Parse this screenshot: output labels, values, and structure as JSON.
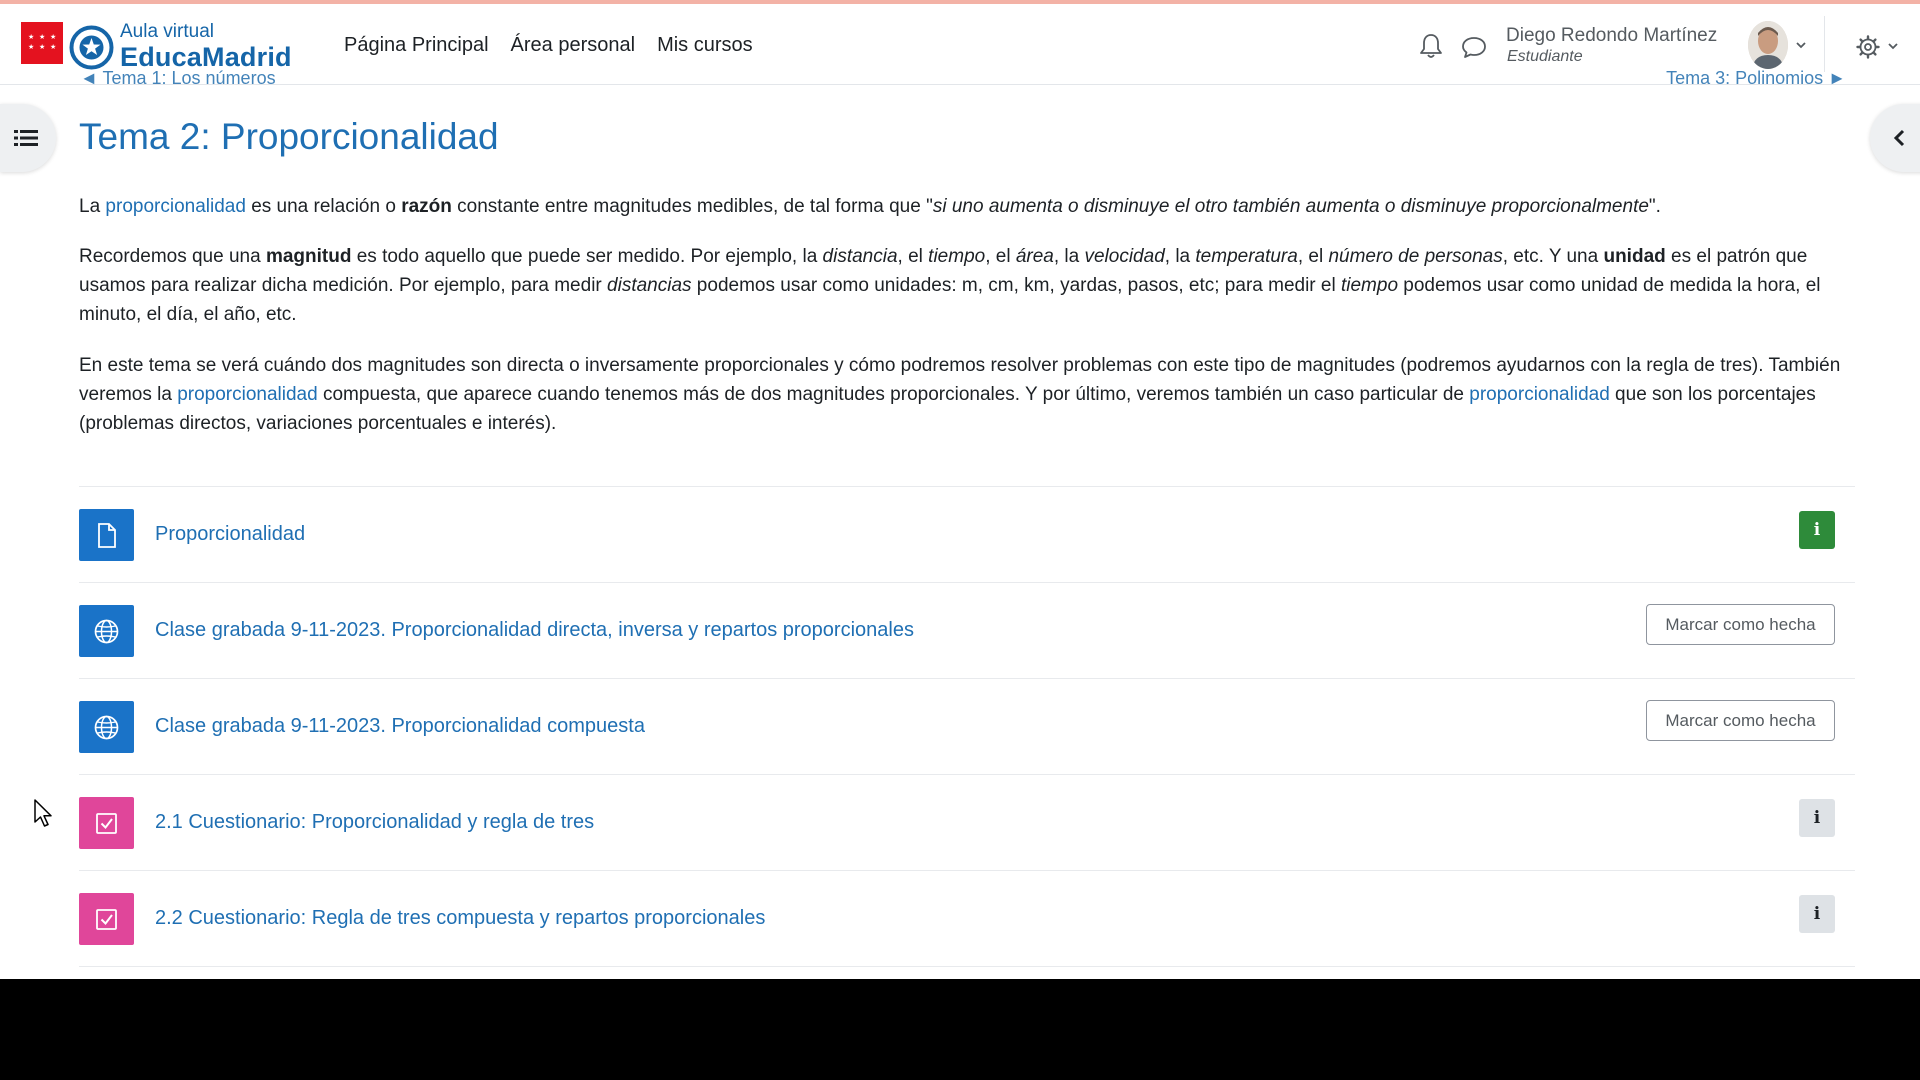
{
  "header": {
    "logo_small": "Aula virtual",
    "logo_big": "EducaMadrid",
    "nav": [
      "Página Principal",
      "Área personal",
      "Mis cursos"
    ],
    "user_name": "Diego Redondo Martínez",
    "user_role": "Estudiante",
    "icons": [
      "bell-icon",
      "chat-icon",
      "gear-icon",
      "chevron-down-icon"
    ]
  },
  "navigation": {
    "prev": "◄ Tema 1: Los números",
    "next": "Tema 3: Polinomios ►"
  },
  "section": {
    "title": "Tema 2: Proporcionalidad",
    "p1": {
      "t1": "La ",
      "link1": "proporcionalidad",
      "t2": " es una relación o ",
      "b1": "razón",
      "t3": " constante entre magnitudes medibles, de tal forma que \"",
      "i1": "si uno aumenta o disminuye el otro también aumenta o disminuye proporcionalmente",
      "t4": "\"."
    },
    "p2": {
      "t1": "Recordemos que una ",
      "b1": "magnitud",
      "t2": " es todo aquello que puede ser medido. Por ejemplo, la ",
      "i1": "distancia",
      "t3": ", el ",
      "i2": "tiempo",
      "t4": ", el ",
      "i3": "área",
      "t5": ", la ",
      "i4": "velocidad",
      "t6": ", la ",
      "i5": "temperatura",
      "t7": ", el ",
      "i6": "número de personas",
      "t8": ", etc. Y una ",
      "b2": "unidad",
      "t9": " es el patrón que usamos para realizar dicha medición. Por ejemplo, para medir ",
      "i7": "distancias",
      "t10": " podemos usar como unidades: m, cm, km, yardas, pasos, etc; para medir el ",
      "i8": "tiempo",
      "t11": " podemos usar como unidad de medida la hora, el minuto, el día, el año, etc."
    },
    "p3": {
      "t1": "En este tema se verá cuándo dos magnitudes son directa o inversamente proporcionales y cómo podremos resolver problemas con este tipo de magnitudes (podremos ayudarnos con la regla de tres). También veremos la ",
      "link1": "proporcionalidad",
      "t2": " compuesta, que aparece cuando tenemos más de dos magnitudes proporcionales. Y por último, veremos también un caso particular de ",
      "link2": "proporcionalidad",
      "t3": " que son los porcentajes (problemas directos, variaciones porcentuales e interés)."
    }
  },
  "activities": [
    {
      "label": "Proporcionalidad",
      "icon": "page-icon",
      "color": "#1a73c8",
      "action": "i"
    },
    {
      "label": "Clase grabada 9-11-2023. Proporcionalidad directa, inversa y repartos proporcionales",
      "icon": "globe-icon",
      "color": "#1a73c8",
      "action": "Marcar como hecha"
    },
    {
      "label": "Clase grabada 9-11-2023. Proporcionalidad compuesta",
      "icon": "globe-icon",
      "color": "#1a73c8",
      "action": "Marcar como hecha"
    },
    {
      "label": "2.1 Cuestionario: Proporcionalidad y regla de tres",
      "icon": "quiz-icon",
      "color": "#e0469a",
      "action": "i"
    },
    {
      "label": "2.2 Cuestionario: Regla de tres compuesta y repartos proporcionales",
      "icon": "quiz-icon",
      "color": "#e0469a",
      "action": "i"
    }
  ],
  "colors": {
    "link": "#1f6fb3",
    "brand": "#1565a8",
    "flag": "#e4121f",
    "info_green": "#2e8b3a"
  }
}
